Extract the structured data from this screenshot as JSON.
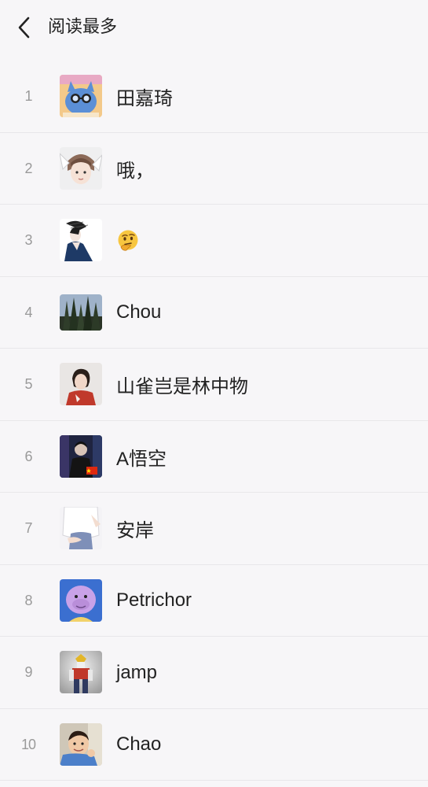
{
  "header": {
    "title": "阅读最多",
    "back_icon": "chevron-left-icon"
  },
  "list": [
    {
      "rank": "1",
      "name": "田嘉琦"
    },
    {
      "rank": "2",
      "name": "哦，"
    },
    {
      "rank": "3",
      "name": "",
      "name_icon": "thinking-face-emoji"
    },
    {
      "rank": "4",
      "name": "Chou"
    },
    {
      "rank": "5",
      "name": "山雀岂是林中物"
    },
    {
      "rank": "6",
      "name": "A悟空"
    },
    {
      "rank": "7",
      "name": "安岸"
    },
    {
      "rank": "8",
      "name": "Petrichor"
    },
    {
      "rank": "9",
      "name": "jamp"
    },
    {
      "rank": "10",
      "name": "Chao"
    }
  ],
  "colors": {
    "background": "#f7f6f8",
    "divider": "#e8e7ea",
    "rank_text": "#9a9a9a",
    "name_text": "#222222"
  }
}
